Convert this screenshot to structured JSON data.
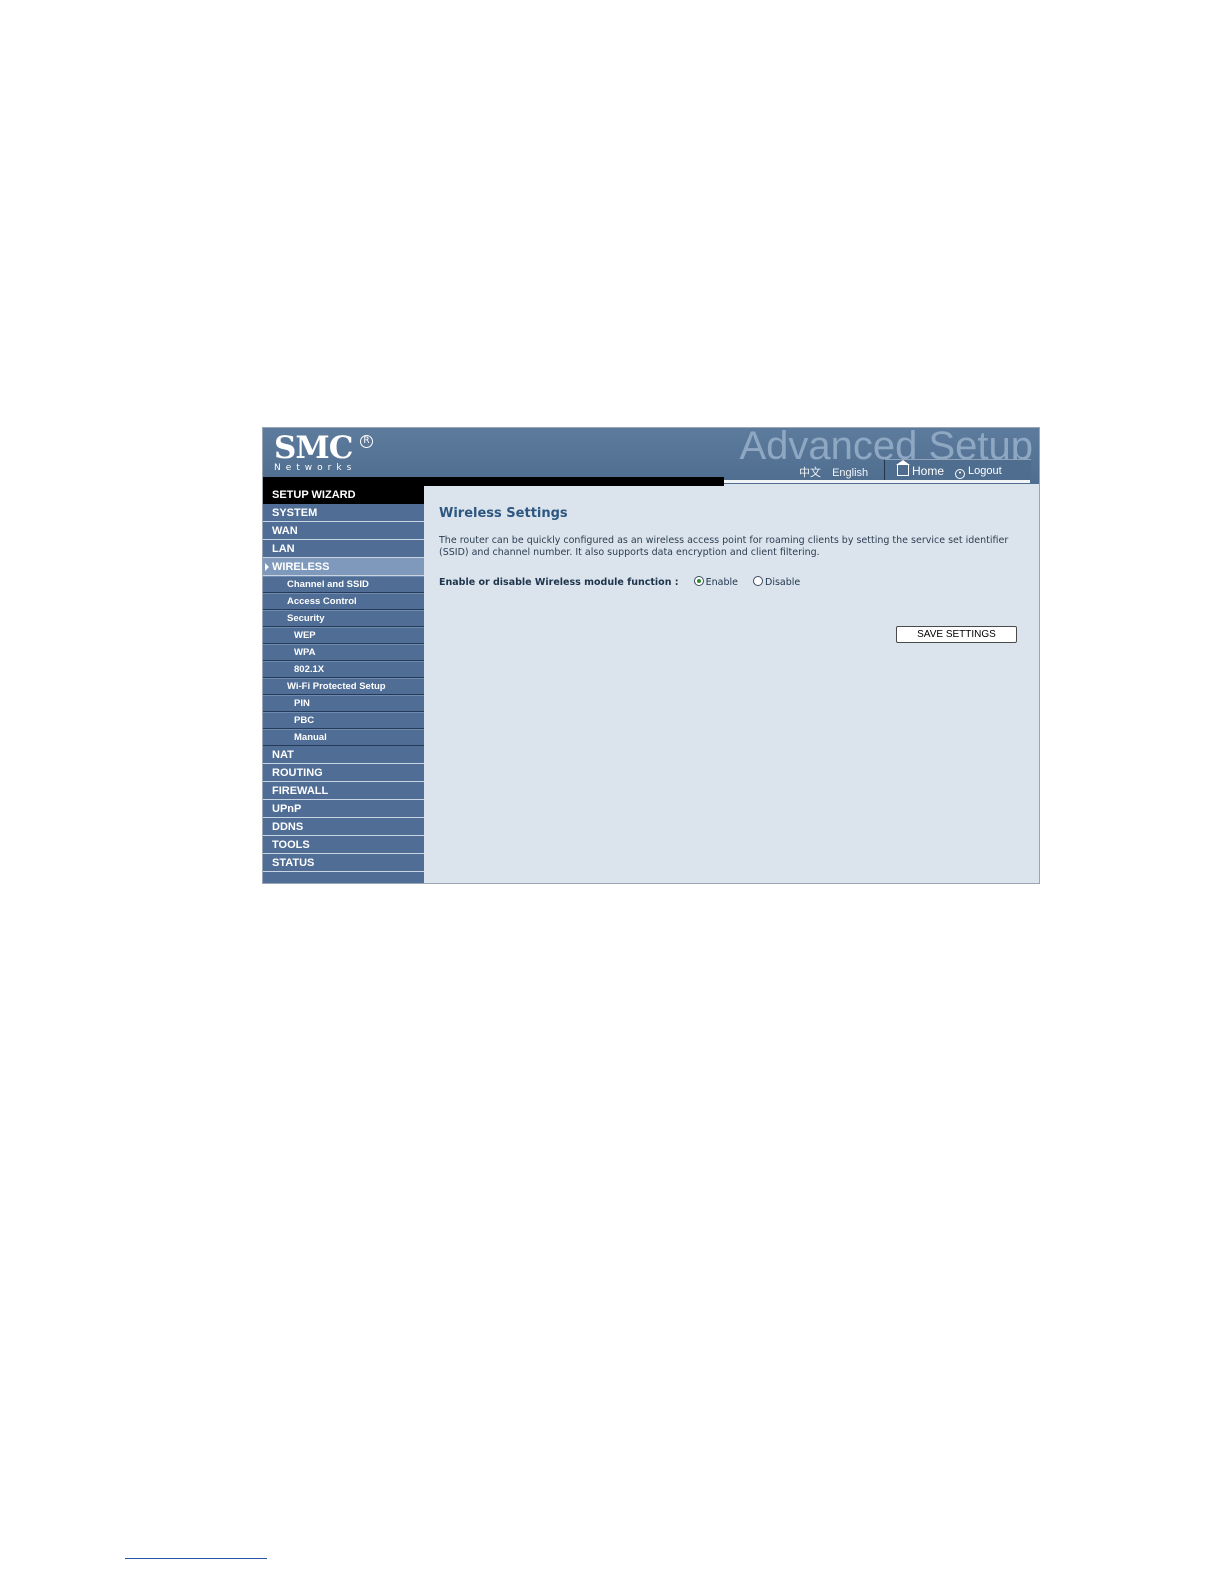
{
  "header": {
    "brand": "SMC",
    "brand_mark": "R",
    "brand_sub": "Networks",
    "title": "Advanced Setup",
    "languages": [
      "中文",
      "English"
    ],
    "home_label": "Home",
    "home_icon": "home-icon",
    "logout_label": "Logout",
    "logout_icon": "logout-icon"
  },
  "sidebar": {
    "items": [
      {
        "label": "SETUP WIZARD"
      },
      {
        "label": "SYSTEM"
      },
      {
        "label": "WAN"
      },
      {
        "label": "LAN"
      },
      {
        "label": "WIRELESS",
        "active": true
      },
      {
        "label": "Channel and SSID"
      },
      {
        "label": "Access Control"
      },
      {
        "label": "Security"
      },
      {
        "label": "WEP"
      },
      {
        "label": "WPA"
      },
      {
        "label": "802.1X"
      },
      {
        "label": "Wi-Fi Protected Setup"
      },
      {
        "label": "PIN"
      },
      {
        "label": "PBC"
      },
      {
        "label": "Manual"
      },
      {
        "label": "NAT"
      },
      {
        "label": "ROUTING"
      },
      {
        "label": "FIREWALL"
      },
      {
        "label": "UPnP"
      },
      {
        "label": "DDNS"
      },
      {
        "label": "TOOLS"
      },
      {
        "label": "STATUS"
      }
    ]
  },
  "main": {
    "title": "Wireless Settings",
    "description": "The router can be quickly configured as an wireless access point for roaming clients by setting the service set identifier (SSID) and channel number. It also supports data encryption and client filtering.",
    "function_label": "Enable or disable Wireless module function :",
    "options": [
      {
        "label": "Enable",
        "selected": true
      },
      {
        "label": "Disable",
        "selected": false
      }
    ],
    "save_label": "SAVE SETTINGS"
  },
  "colors": {
    "header": "#4f6d8f",
    "sidebar": "#4f6d95",
    "active_item": "#7e99bc",
    "content": "#dbe4ec",
    "title": "#2d5680"
  }
}
